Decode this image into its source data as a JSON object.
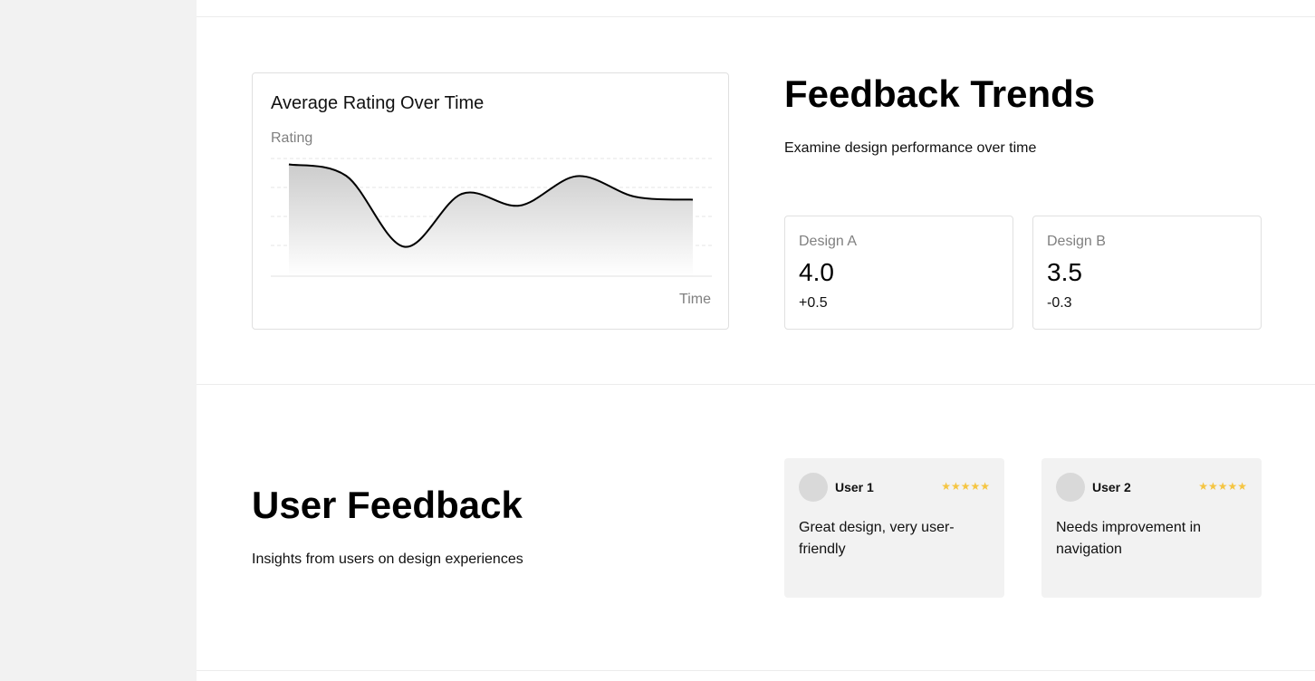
{
  "chart": {
    "title": "Average Rating Over Time",
    "ylabel": "Rating",
    "xlabel": "Time"
  },
  "chart_data": {
    "type": "area",
    "title": "Average Rating Over Time",
    "xlabel": "Time",
    "ylabel": "Rating",
    "x": [
      0,
      1,
      2,
      3,
      4,
      5,
      6,
      7
    ],
    "values": [
      3.8,
      3.4,
      1.0,
      2.8,
      2.4,
      3.4,
      2.7,
      2.6
    ],
    "ylim": [
      0,
      4
    ],
    "grid": true,
    "colors": {
      "line": "#000000",
      "fill_top": "#cccccc",
      "fill_bottom": "#ffffff"
    }
  },
  "trends": {
    "title": "Feedback Trends",
    "subtitle": "Examine design performance over time",
    "stats": [
      {
        "name": "Design A",
        "value": "4.0",
        "delta": "+0.5"
      },
      {
        "name": "Design B",
        "value": "3.5",
        "delta": "-0.3"
      }
    ]
  },
  "feedback": {
    "title": "User Feedback",
    "subtitle": "Insights from users on design experiences",
    "items": [
      {
        "user": "User 1",
        "stars": "★★★★★",
        "text": "Great design, very user-friendly",
        "rating": 5
      },
      {
        "user": "User 2",
        "stars": "★★★★★",
        "text": "Needs improvement in navigation",
        "rating": 5
      }
    ]
  },
  "colors": {
    "sidebar": "#f2f2f2",
    "star": "#f5c542",
    "card_bg": "#f2f2f2"
  }
}
